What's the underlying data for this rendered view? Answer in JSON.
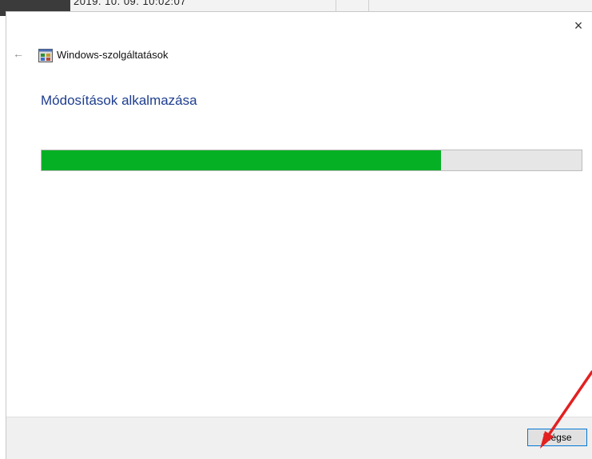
{
  "background": {
    "partial_text": "2019. 10. 09. 10:02:07"
  },
  "window": {
    "close_label": "×",
    "back_label": "←",
    "title": "Windows-szolgáltatások",
    "icon": "windows-features-icon"
  },
  "main": {
    "heading": "Módosítások alkalmazása",
    "progress_percent": 74
  },
  "footer": {
    "cancel_label": "Mégse"
  },
  "colors": {
    "heading": "#1e3d8f",
    "progress_fill": "#06b025",
    "progress_track": "#e6e6e6",
    "annotation_arrow": "#e32020",
    "button_focus_border": "#0078d7"
  }
}
